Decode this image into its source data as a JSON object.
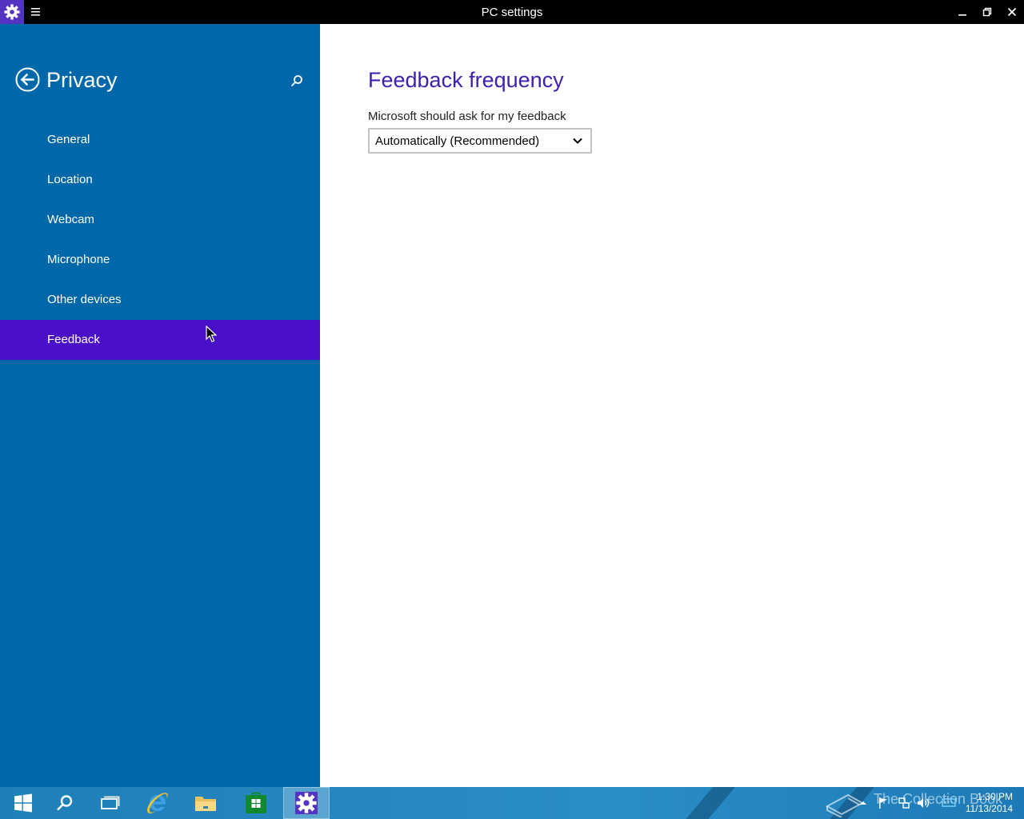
{
  "window": {
    "title": "PC settings"
  },
  "sidebar": {
    "title": "Privacy",
    "items": [
      {
        "label": "General"
      },
      {
        "label": "Location"
      },
      {
        "label": "Webcam"
      },
      {
        "label": "Microphone"
      },
      {
        "label": "Other devices"
      },
      {
        "label": "Feedback",
        "selected": true
      }
    ]
  },
  "main": {
    "section_title": "Feedback frequency",
    "field_label": "Microsoft should ask for my feedback",
    "dropdown_value": "Automatically (Recommended)"
  },
  "taskbar": {
    "watermark": "The Collection Book",
    "time": "1:30 PM",
    "date": "11/13/2014"
  },
  "colors": {
    "sidebar_bg": "#0068a8",
    "selected_bg": "#4a10c8",
    "accent_title": "#3f1fb0",
    "titlebar_bg": "#000000"
  }
}
